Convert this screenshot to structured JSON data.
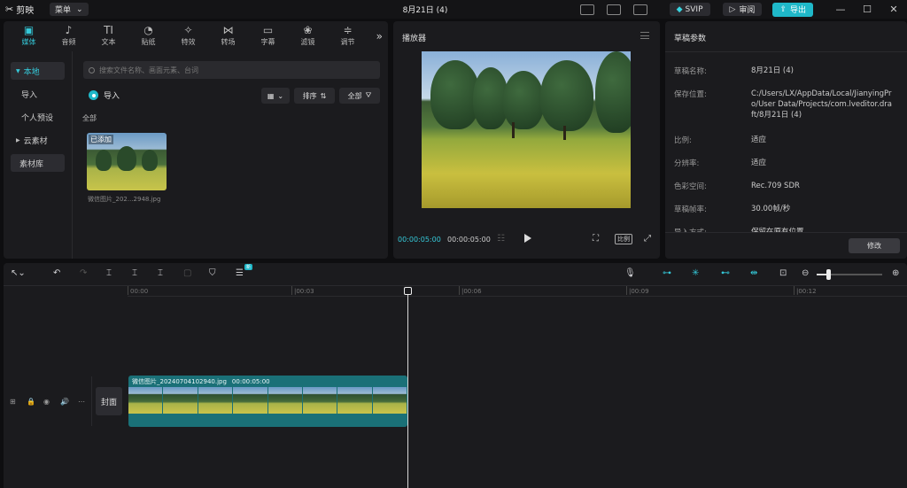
{
  "app": {
    "logo_text": "剪映",
    "menu_label": "菜单",
    "title": "8月21日 (4)",
    "svip_label": "SVIP",
    "review_label": "审阅",
    "export_label": "导出",
    "win_min": "—",
    "win_max": "☐",
    "win_close": "✕"
  },
  "media": {
    "tools": [
      {
        "label": "媒体",
        "glyph": "▣"
      },
      {
        "label": "音频",
        "glyph": "♪"
      },
      {
        "label": "文本",
        "glyph": "TI"
      },
      {
        "label": "贴纸",
        "glyph": "◔"
      },
      {
        "label": "特效",
        "glyph": "✧"
      },
      {
        "label": "转场",
        "glyph": "⋈"
      },
      {
        "label": "字幕",
        "glyph": "▭"
      },
      {
        "label": "滤镜",
        "glyph": "❀"
      },
      {
        "label": "调节",
        "glyph": "≑"
      }
    ],
    "more": "»",
    "sidenav": [
      "本地",
      "导入",
      "个人预设",
      "云素材",
      "素材库"
    ],
    "search_placeholder": "搜索文件名称、画面元素、台词",
    "import_label": "导入",
    "sort_label": "排序",
    "all_filter_label": "全部",
    "all_section_label": "全部",
    "thumb_badge": "已添加",
    "thumb_name": "微信图片_202...2948.jpg"
  },
  "player": {
    "title": "播放器",
    "time_current": "00:00:05:00",
    "time_total": "00:00:05:00",
    "ratio_label": "比例"
  },
  "draft": {
    "title": "草稿参数",
    "rows": [
      {
        "key": "草稿名称:",
        "value": "8月21日 (4)"
      },
      {
        "key": "保存位置:",
        "value": "C:/Users/LX/AppData/Local/JianyingPro/User Data/Projects/com.lveditor.draft/8月21日 (4)"
      },
      {
        "key": "比例:",
        "value": "适应"
      },
      {
        "key": "分辨率:",
        "value": "适应"
      },
      {
        "key": "色彩空间:",
        "value": "Rec.709 SDR"
      },
      {
        "key": "草稿帧率:",
        "value": "30.00帧/秒"
      },
      {
        "key": "导入方式:",
        "value": "保留在原有位置"
      }
    ],
    "modify_label": "修改"
  },
  "timeline": {
    "badge": "新",
    "ruler": [
      "00:00",
      "|00:03",
      "|00:06",
      "|00:09",
      "|00:12"
    ],
    "cover_label": "封面",
    "clip_name": "微信图片_20240704102940.jpg",
    "clip_duration": "00:00:05:00"
  }
}
